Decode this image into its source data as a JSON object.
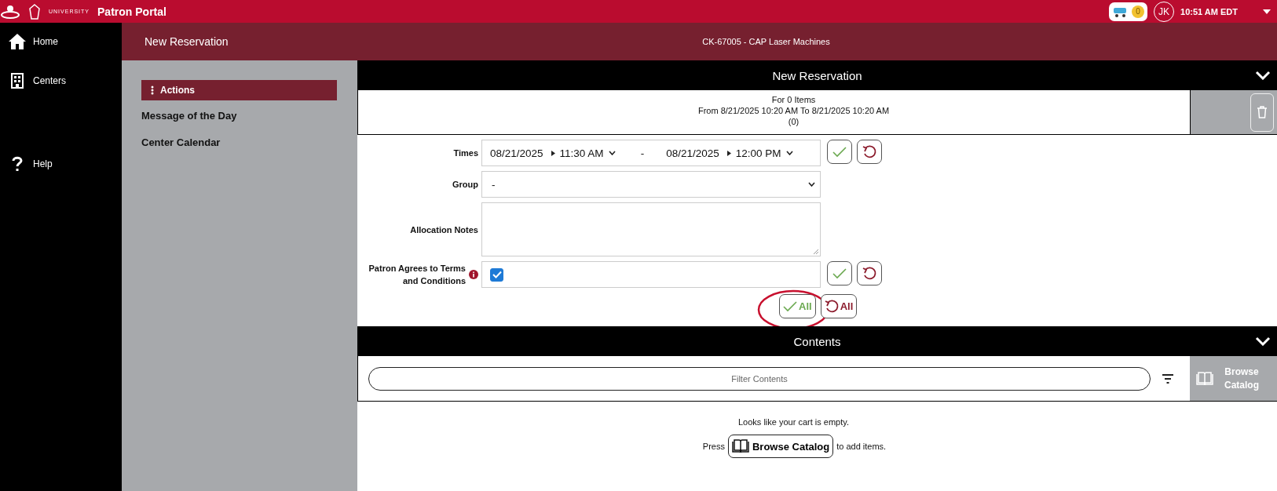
{
  "top_bar": {
    "university": "UNIVERSITY",
    "title": "Patron Portal",
    "cart_count": "0",
    "avatar": "JK",
    "time": "10:51 AM EDT"
  },
  "sidebar": {
    "items": [
      {
        "label": "Home"
      },
      {
        "label": "Centers"
      },
      {
        "label": "Help"
      }
    ]
  },
  "header": {
    "title": "New Reservation",
    "center": "CK-67005 - CAP Laser Machines"
  },
  "actions_panel": {
    "heading": "Actions",
    "items": [
      "Message of the Day",
      "Center Calendar"
    ]
  },
  "reservation": {
    "title": "New Reservation",
    "expanded": true,
    "summary": [
      "For 0 Items",
      "From 8/21/2025 10:20 AM To 8/21/2025 10:20 AM",
      "(0)"
    ],
    "fields": [
      {
        "kind": "times",
        "label": "Times",
        "start_date": "08/21/2025",
        "start_time": "11:30 AM",
        "separator": "-",
        "end_date": "08/21/2025",
        "end_time": "12:00 PM",
        "actions": true
      },
      {
        "kind": "select",
        "label": "Group",
        "value": "-",
        "actions": false
      },
      {
        "kind": "textarea",
        "label": "Allocation Notes",
        "actions": false
      },
      {
        "kind": "checkbox",
        "label": "Patron Agrees to Terms and Conditions",
        "info": true,
        "checked": true,
        "actions": true
      }
    ],
    "all_buttons": [
      {
        "kind": "confirm",
        "label": "All",
        "highlighted": true
      },
      {
        "kind": "undo",
        "label": "All",
        "highlighted": false
      }
    ]
  },
  "contents": {
    "title": "Contents",
    "expanded": true,
    "filter_placeholder": "Filter Contents",
    "browse_button": "Browse Catalog",
    "empty_message": "Looks like your cart is empty.",
    "press_before": "Press",
    "press_button": "Browse Catalog",
    "press_after": "to add items."
  }
}
